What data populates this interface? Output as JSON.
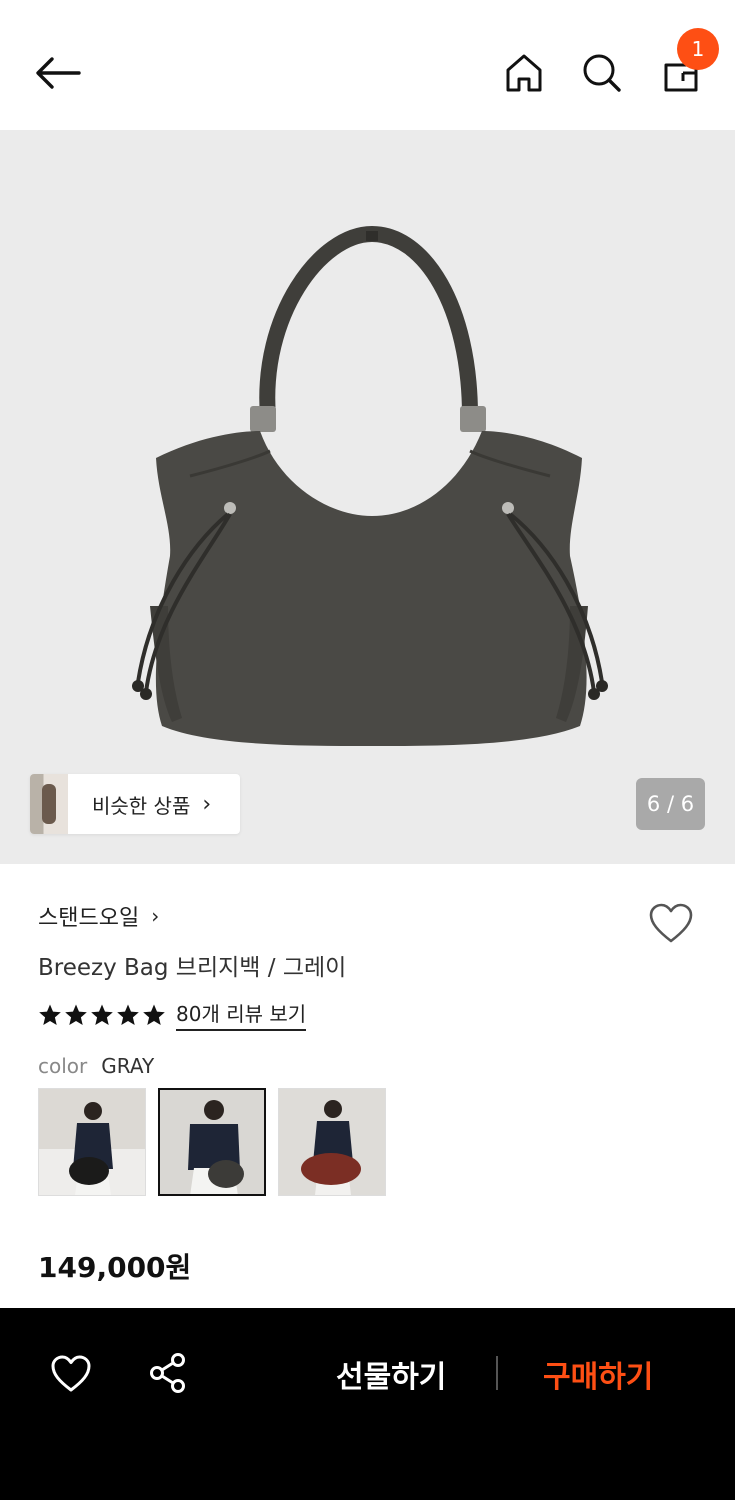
{
  "header": {
    "cart_badge": "1",
    "icons": [
      "arrow-left-icon",
      "home-icon",
      "search-icon",
      "shopping-bag-icon"
    ]
  },
  "gallery": {
    "similar_label": "비슷한 상품",
    "counter": "6 / 6"
  },
  "product": {
    "brand": "스탠드오일",
    "title": "Breezy Bag 브리지백 / 그레이",
    "rating_stars": 5,
    "review_link": "80개 리뷰 보기",
    "color_label": "color",
    "color_value": "GRAY",
    "price": "149,000원",
    "bag_color": "#4a4945"
  },
  "bottom_bar": {
    "gift_label": "선물하기",
    "buy_label": "구매하기",
    "accent_color": "#fe4f14"
  }
}
